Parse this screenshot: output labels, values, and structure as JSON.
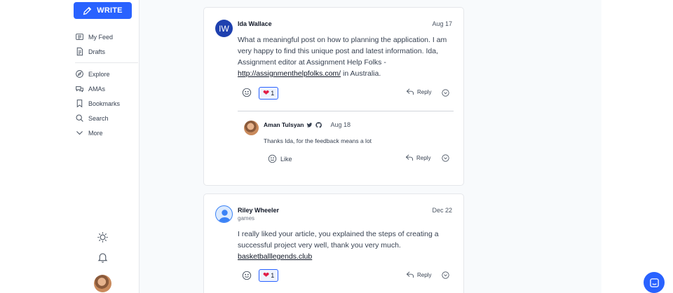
{
  "sidebar": {
    "write_label": "WRITE",
    "items": [
      {
        "label": "My Feed",
        "icon": "feed-icon"
      },
      {
        "label": "Drafts",
        "icon": "drafts-icon"
      },
      {
        "label": "Explore",
        "icon": "explore-icon"
      },
      {
        "label": "AMAs",
        "icon": "amas-icon"
      },
      {
        "label": "Bookmarks",
        "icon": "bookmark-icon"
      },
      {
        "label": "Search",
        "icon": "search-icon"
      },
      {
        "label": "More",
        "icon": "chevron-down-icon"
      }
    ]
  },
  "comments": [
    {
      "avatar_initials": "IW",
      "author": "Ida Wallace",
      "date": "Aug 17",
      "text_before": "What a meaningful post on how to planning the application. I am very happy to find this unique post and latest information. Ida, Assignment editor at Assignment Help Folks - ",
      "link": "http://assignmenthelpfolks.com/",
      "text_after": " in Australia.",
      "likes": "1",
      "reply_label": "Reply",
      "reply": {
        "author": "Aman Tulsyan",
        "date": "Aug 18",
        "text": "Thanks Ida, for the feedback means a lot",
        "like_label": "Like",
        "reply_label": "Reply"
      }
    },
    {
      "author": "Riley Wheeler",
      "subtitle": "games",
      "date": "Dec 22",
      "text": "I really liked your article, you explained the steps of creating a successful project very well, thank you very much.",
      "link": "basketballlegends.club",
      "likes": "1",
      "reply_label": "Reply"
    }
  ],
  "colors": {
    "accent": "#2962ff",
    "heart": "#e11d48"
  }
}
